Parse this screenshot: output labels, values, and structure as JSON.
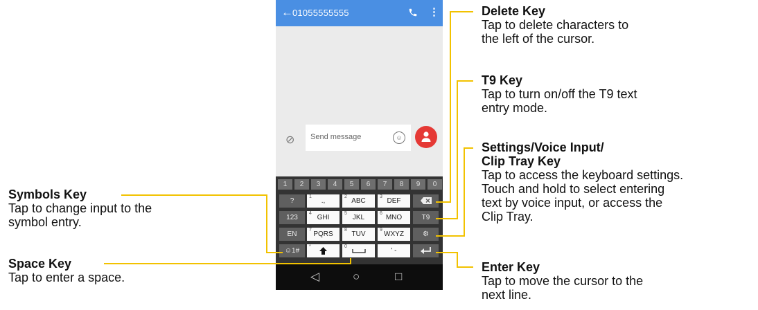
{
  "phone": {
    "header": {
      "phone_number": "01055555555"
    },
    "compose": {
      "placeholder": "Send message"
    },
    "keyboard": {
      "number_row": [
        "1",
        "2",
        "3",
        "4",
        "5",
        "6",
        "7",
        "8",
        "9",
        "0"
      ],
      "rows": [
        {
          "left": "?",
          "keys": [
            {
              "digit": "1",
              "label": ".,"
            },
            {
              "digit": "2",
              "label": "ABC"
            },
            {
              "digit": "3",
              "label": "DEF"
            }
          ]
        },
        {
          "left": "123",
          "keys": [
            {
              "digit": "4",
              "label": "GHI"
            },
            {
              "digit": "5",
              "label": "JKL"
            },
            {
              "digit": "6",
              "label": "MNO"
            }
          ],
          "right": "T9"
        },
        {
          "left": "EN",
          "keys": [
            {
              "digit": "7",
              "label": "PQRS"
            },
            {
              "digit": "8",
              "label": "TUV"
            },
            {
              "digit": "9",
              "label": "WXYZ"
            }
          ]
        },
        {
          "left": "☺1#",
          "keys": [
            {
              "digit": "*",
              "label": ""
            },
            {
              "digit": "0",
              "label": ""
            },
            {
              "digit": "#",
              "label": "' -"
            }
          ]
        }
      ]
    }
  },
  "annotations": {
    "symbols_key": {
      "title": "Symbols Key",
      "desc": [
        "Tap to change input to the",
        "symbol entry."
      ]
    },
    "space_key": {
      "title": "Space Key",
      "desc": [
        "Tap to enter a space."
      ]
    },
    "delete_key": {
      "title": "Delete Key",
      "desc": [
        "Tap to delete characters to",
        "the left of the cursor."
      ]
    },
    "t9_key": {
      "title": "T9 Key",
      "desc": [
        "Tap to turn on/off the T9 text",
        "entry mode."
      ]
    },
    "settings_key": {
      "title": [
        "Settings/Voice Input/",
        "Clip Tray Key"
      ],
      "desc": [
        "Tap to access the keyboard settings.",
        "Touch and hold to select entering",
        "text by voice input, or access the",
        "Clip Tray."
      ]
    },
    "enter_key": {
      "title": "Enter Key",
      "desc": [
        "Tap to move the cursor to the",
        "next line."
      ]
    }
  },
  "colors": {
    "appbar": "#4a8fe3",
    "send_button": "#e53935",
    "callout_line": "#f2c200",
    "keyboard_bg": "#333333"
  }
}
